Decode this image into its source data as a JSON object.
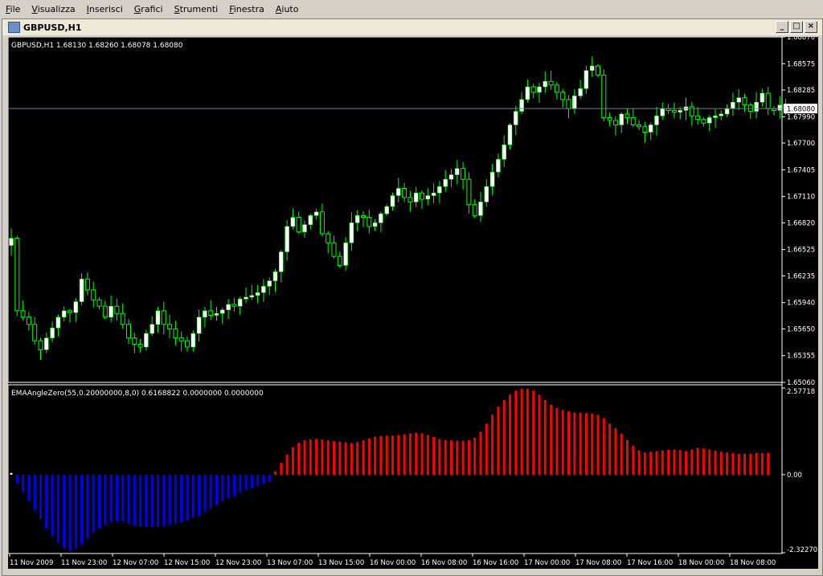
{
  "menu": [
    "File",
    "Visualizza",
    "Inserisci",
    "Grafici",
    "Strumenti",
    "Finestra",
    "Aiuto"
  ],
  "window": {
    "title": "GBPUSD,H1",
    "buttons": [
      "_",
      "□",
      "×"
    ]
  },
  "colors": {
    "bg": "#000000",
    "grid": "#ffffff",
    "bull_wick": "#00ff00",
    "bull_body": "#ffffff",
    "up_hist": "#ff0000",
    "down_hist": "#0000ff",
    "bid_line": "#708090"
  },
  "chart_data": [
    {
      "type": "candlestick",
      "title": "GBPUSD,H1  1.68130 1.68260 1.68078 1.68080",
      "ylim": [
        1.6506,
        1.6887
      ],
      "y_ticks": [
        "1.68870",
        "1.68575",
        "1.68285",
        "1.67990",
        "1.67700",
        "1.67405",
        "1.67110",
        "1.66820",
        "1.66525",
        "1.66235",
        "1.65940",
        "1.65650",
        "1.65355",
        "1.65060"
      ],
      "current_price": "1.68080",
      "x_labels": [
        "11 Nov 2009",
        "11 Nov 23:00",
        "12 Nov 07:00",
        "12 Nov 15:00",
        "12 Nov 23:00",
        "13 Nov 07:00",
        "13 Nov 15:00",
        "16 Nov 00:00",
        "16 Nov 08:00",
        "16 Nov 16:00",
        "17 Nov 00:00",
        "17 Nov 08:00",
        "17 Nov 16:00",
        "18 Nov 00:00",
        "18 Nov 08:00"
      ],
      "close_series": [
        1.6665,
        1.6585,
        1.6578,
        1.657,
        1.6552,
        1.6542,
        1.6555,
        1.6566,
        1.6578,
        1.6585,
        1.6583,
        1.6595,
        1.662,
        1.6608,
        1.6597,
        1.659,
        1.6578,
        1.659,
        1.6582,
        1.657,
        1.6555,
        1.6548,
        1.6545,
        1.656,
        1.657,
        1.6585,
        1.657,
        1.6565,
        1.6555,
        1.6552,
        1.6545,
        1.656,
        1.6578,
        1.6585,
        1.658,
        1.6582,
        1.6586,
        1.6592,
        1.659,
        1.6598,
        1.66,
        1.6602,
        1.6605,
        1.6612,
        1.6618,
        1.6628,
        1.665,
        1.6678,
        1.6688,
        1.6672,
        1.668,
        1.669,
        1.6694,
        1.667,
        1.666,
        1.6645,
        1.6635,
        1.666,
        1.6682,
        1.669,
        1.6688,
        1.6678,
        1.6682,
        1.6692,
        1.67,
        1.6712,
        1.672,
        1.671,
        1.6705,
        1.6715,
        1.6708,
        1.6712,
        1.6715,
        1.6722,
        1.673,
        1.6735,
        1.6742,
        1.673,
        1.6702,
        1.669,
        1.6705,
        1.6722,
        1.6738,
        1.6752,
        1.6768,
        1.679,
        1.6805,
        1.6818,
        1.6832,
        1.6826,
        1.6832,
        1.6838,
        1.6834,
        1.6826,
        1.6818,
        1.6808,
        1.6822,
        1.683,
        1.685,
        1.6855,
        1.6845,
        1.6798,
        1.6795,
        1.679,
        1.6802,
        1.6798,
        1.679,
        1.6788,
        1.6782,
        1.679,
        1.68,
        1.6808,
        1.6806,
        1.6804,
        1.6806,
        1.681,
        1.68,
        1.6796,
        1.6792,
        1.6798,
        1.68,
        1.6802,
        1.6808,
        1.6815,
        1.682,
        1.6812,
        1.6805,
        1.6815,
        1.6825,
        1.6808,
        1.6806,
        1.6812,
        1.6808
      ]
    },
    {
      "type": "bar",
      "title": "EMAAngleZero(55,0.20000000,8,0) 0.6168822 0.0000000 0.0000000",
      "ylim": [
        -2.3227,
        2.57718
      ],
      "y_ticks": [
        "2.57718",
        "0.00",
        "-2.32270"
      ],
      "values": [
        0.05,
        -0.25,
        -0.52,
        -0.78,
        -1.05,
        -1.32,
        -1.58,
        -1.82,
        -2.02,
        -2.18,
        -2.26,
        -2.22,
        -2.08,
        -1.9,
        -1.72,
        -1.58,
        -1.5,
        -1.42,
        -1.38,
        -1.4,
        -1.46,
        -1.52,
        -1.55,
        -1.56,
        -1.56,
        -1.55,
        -1.53,
        -1.5,
        -1.46,
        -1.42,
        -1.36,
        -1.28,
        -1.2,
        -1.1,
        -1.0,
        -0.9,
        -0.8,
        -0.7,
        -0.62,
        -0.54,
        -0.46,
        -0.4,
        -0.34,
        -0.28,
        -0.22,
        0.1,
        0.35,
        0.6,
        0.82,
        0.95,
        1.02,
        1.05,
        1.06,
        1.05,
        1.02,
        1.0,
        0.98,
        0.96,
        0.94,
        0.97,
        1.02,
        1.08,
        1.13,
        1.15,
        1.16,
        1.16,
        1.18,
        1.2,
        1.23,
        1.25,
        1.23,
        1.18,
        1.12,
        1.06,
        1.03,
        1.02,
        1.01,
        1.01,
        1.03,
        1.1,
        1.28,
        1.52,
        1.78,
        2.02,
        2.22,
        2.38,
        2.5,
        2.56,
        2.56,
        2.5,
        2.38,
        2.22,
        2.08,
        1.98,
        1.92,
        1.88,
        1.85,
        1.84,
        1.83,
        1.82,
        1.78,
        1.68,
        1.52,
        1.38,
        1.22,
        1.03,
        0.86,
        0.72,
        0.66,
        0.68,
        0.7,
        0.72,
        0.74,
        0.75,
        0.73,
        0.7,
        0.75,
        0.8,
        0.78,
        0.75,
        0.72,
        0.68,
        0.66,
        0.64,
        0.62,
        0.62,
        0.62,
        0.64,
        0.64,
        0.65
      ]
    }
  ]
}
